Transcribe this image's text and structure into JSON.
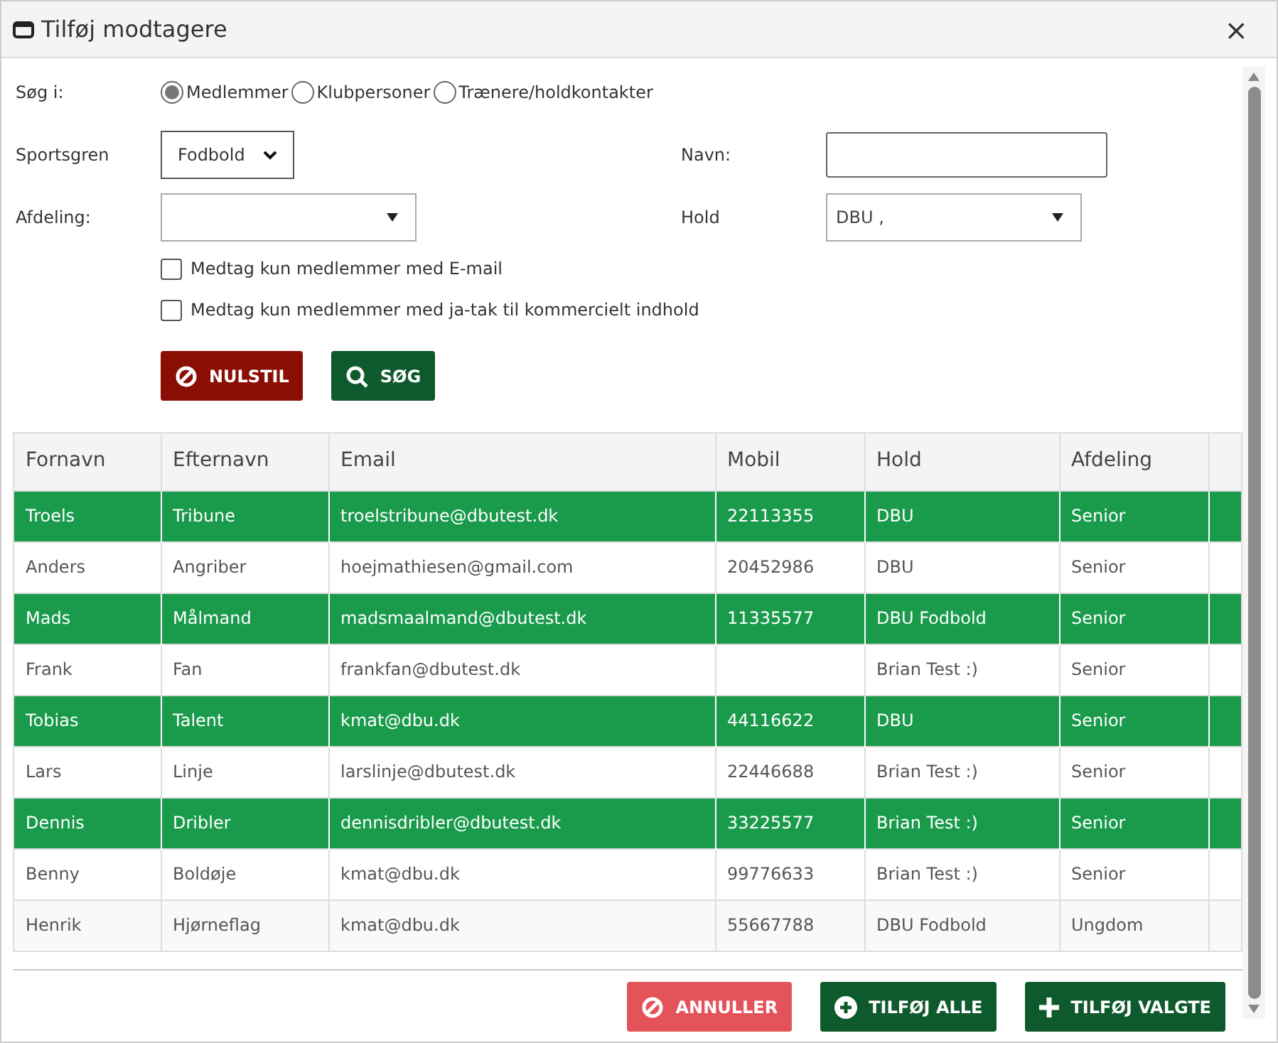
{
  "window": {
    "title": "Tilføj modtagere",
    "close": "×"
  },
  "search_in": {
    "label": "Søg i:",
    "options": [
      {
        "label": "Medlemmer",
        "selected": true
      },
      {
        "label": "Klubpersoner",
        "selected": false
      },
      {
        "label": "Trænere/holdkontakter",
        "selected": false
      }
    ]
  },
  "sport": {
    "label": "Sportsgren",
    "value": "Fodbold"
  },
  "name": {
    "label": "Navn:"
  },
  "department": {
    "label": "Afdeling:"
  },
  "team": {
    "label": "Hold",
    "value": "DBU ,"
  },
  "filters": [
    {
      "label": "Medtag kun medlemmer med E-mail",
      "checked": false
    },
    {
      "label": "Medtag kun medlemmer med ja-tak til kommercielt indhold",
      "checked": false
    }
  ],
  "search_buttons": [
    "NULSTIL",
    "SØG"
  ],
  "table": {
    "columns": [
      "Fornavn",
      "Efternavn",
      "Email",
      "Mobil",
      "Hold",
      "Afdeling"
    ],
    "rows": [
      {
        "cells": [
          "Troels",
          "Tribune",
          "troelstribune@dbutest.dk",
          "22113355",
          "DBU",
          "Senior"
        ],
        "selected": true
      },
      {
        "cells": [
          "Anders",
          "Angriber",
          "hoejmathiesen@gmail.com",
          "20452986",
          "DBU",
          "Senior"
        ],
        "selected": false
      },
      {
        "cells": [
          "Mads",
          "Målmand",
          "madsmaalmand@dbutest.dk",
          "11335577",
          "DBU Fodbold",
          "Senior"
        ],
        "selected": true
      },
      {
        "cells": [
          "Frank",
          "Fan",
          "frankfan@dbutest.dk",
          "",
          "Brian Test :)",
          "Senior"
        ],
        "selected": false
      },
      {
        "cells": [
          "Tobias",
          "Talent",
          "kmat@dbu.dk",
          "44116622",
          "DBU",
          "Senior"
        ],
        "selected": true
      },
      {
        "cells": [
          "Lars",
          "Linje",
          "larslinje@dbutest.dk",
          "22446688",
          "Brian Test :)",
          "Senior"
        ],
        "selected": false
      },
      {
        "cells": [
          "Dennis",
          "Dribler",
          "dennisdribler@dbutest.dk",
          "33225577",
          "Brian Test :)",
          "Senior"
        ],
        "selected": true
      },
      {
        "cells": [
          "Benny",
          "Boldøje",
          "kmat@dbu.dk",
          "99776633",
          "Brian Test :)",
          "Senior"
        ],
        "selected": false
      },
      {
        "cells": [
          "Henrik",
          "Hjørneflag",
          "kmat@dbu.dk",
          "55667788",
          "DBU Fodbold",
          "Ungdom"
        ],
        "selected": false
      }
    ]
  },
  "footer_buttons": [
    {
      "label": "ANNULLER",
      "kind": "cancel"
    },
    {
      "label": "TILFØJ ALLE",
      "kind": "add-all"
    },
    {
      "label": "TILFØJ VALGTE",
      "kind": "add-selected"
    }
  ]
}
